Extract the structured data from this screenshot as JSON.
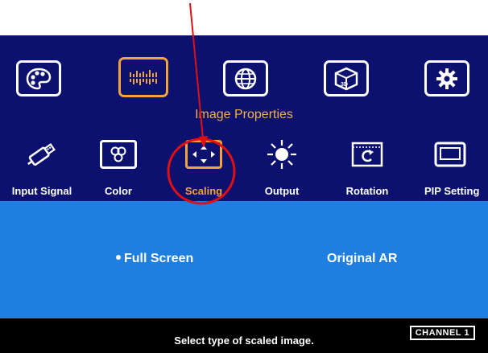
{
  "top_menu": {
    "items": [
      {
        "icon": "palette-icon"
      },
      {
        "icon": "equalizer-icon",
        "active": true
      },
      {
        "icon": "globe-icon"
      },
      {
        "icon": "3d-cube-icon"
      },
      {
        "icon": "gear-icon"
      }
    ]
  },
  "section_title": "Image Properties",
  "sub_menu": {
    "items": [
      {
        "label": "Input Signal",
        "icon": "usb-plug-icon"
      },
      {
        "label": "Color",
        "icon": "color-icon"
      },
      {
        "label": "Scaling",
        "icon": "scaling-arrows-icon",
        "active": true
      },
      {
        "label": "Output",
        "icon": "sun-icon"
      },
      {
        "label": "Rotation",
        "icon": "rotation-icon"
      },
      {
        "label": "PIP Setting",
        "icon": "pip-window-icon"
      }
    ]
  },
  "options": {
    "full_screen": "Full Screen",
    "original_ar": "Original AR",
    "selected": "Full Screen"
  },
  "status_bar": {
    "hint": "Select type of scaled image.",
    "channel": "CHANNEL 1"
  },
  "colors": {
    "osd_background": "#0c1170",
    "accent": "#f2a33a",
    "panel": "#1e7fe0",
    "annotation": "#e01010"
  }
}
